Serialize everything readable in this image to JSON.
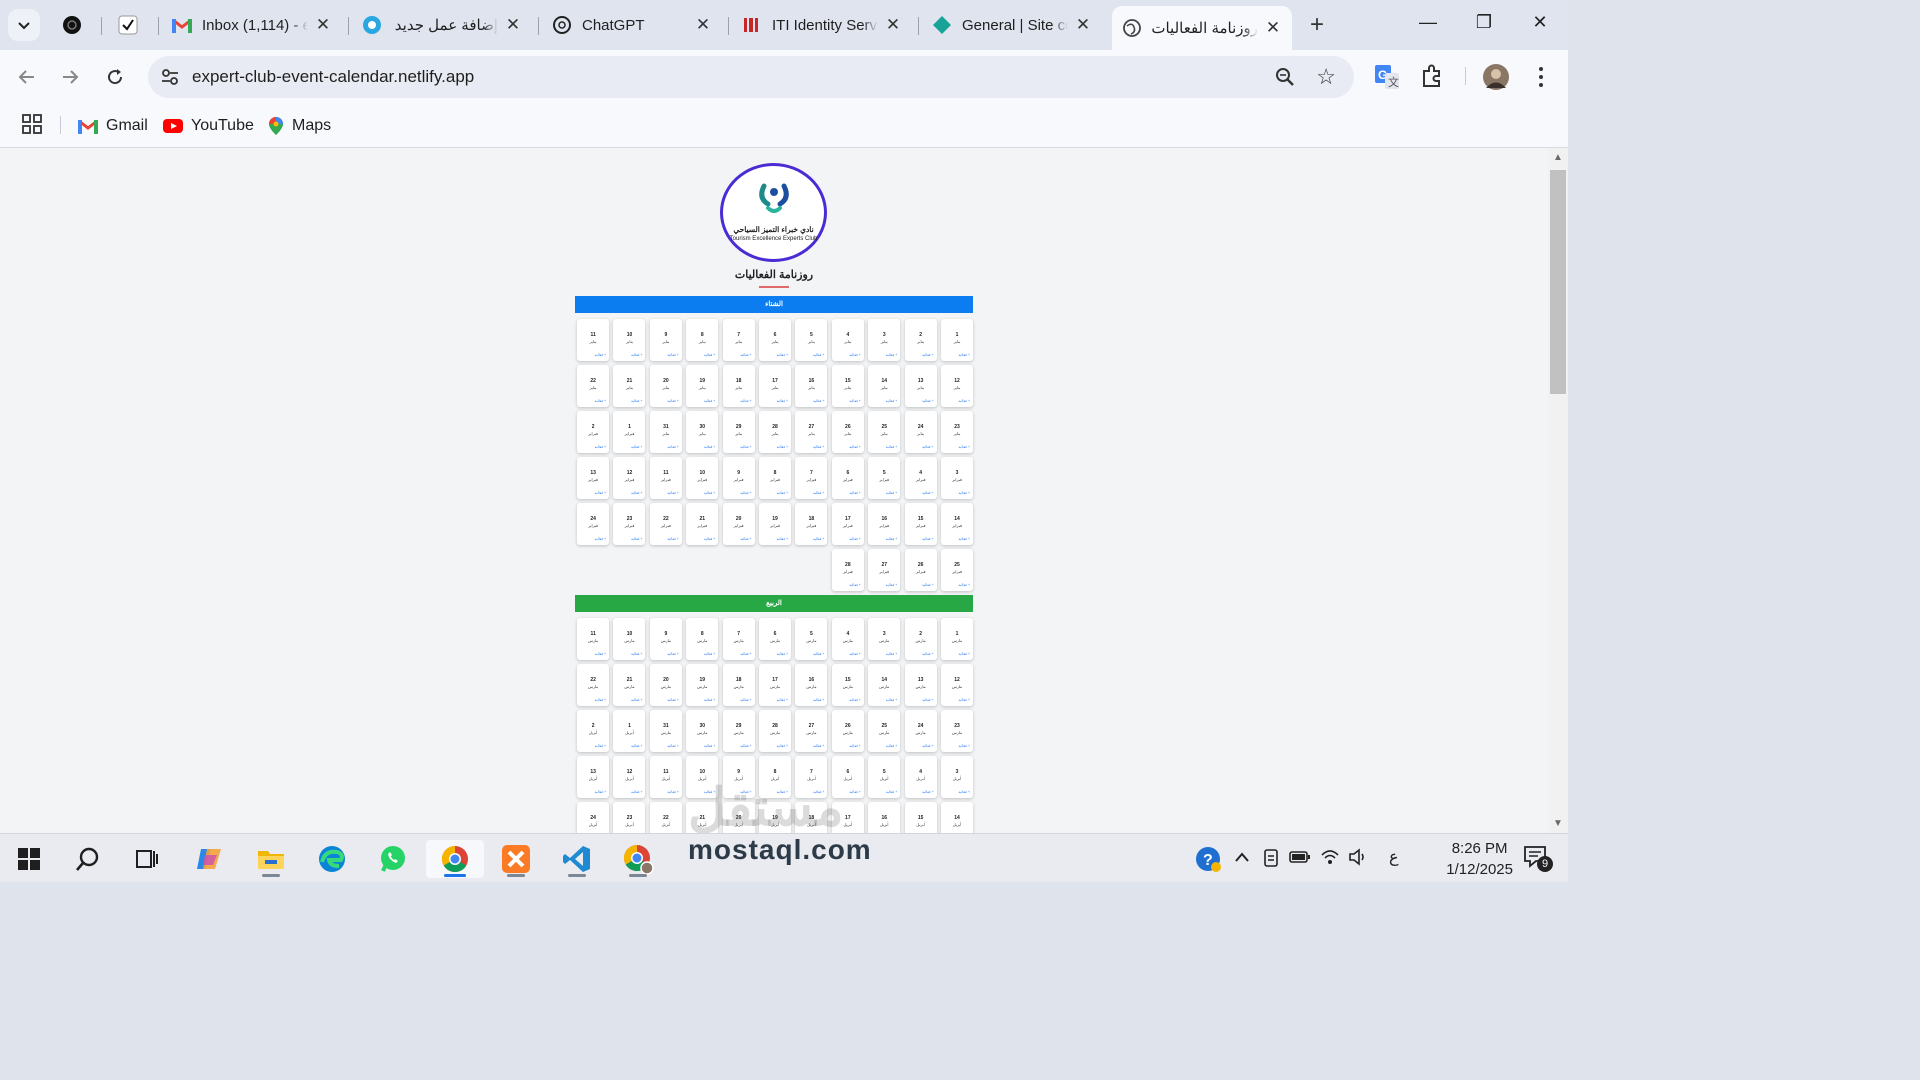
{
  "browser": {
    "tabs": [
      {
        "title": "",
        "favicon": "openai-dark-icon",
        "close": ""
      },
      {
        "title": "",
        "favicon": "checkmark-icon",
        "close": ""
      },
      {
        "title": "Inbox (1,114) - e",
        "favicon": "gmail-icon",
        "close": "✕"
      },
      {
        "title": "إضافة عمل جديد",
        "favicon": "mostaql-icon",
        "close": "✕"
      },
      {
        "title": "ChatGPT",
        "favicon": "chatgpt-icon",
        "close": "✕"
      },
      {
        "title": "ITI Identity Serv",
        "favicon": "iti-icon",
        "close": "✕"
      },
      {
        "title": "General | Site co",
        "favicon": "diamond-icon",
        "close": "✕"
      },
      {
        "title": "روزنامة الفعاليات",
        "favicon": "globe-icon",
        "close": "✕",
        "active": true
      }
    ],
    "new_tab": "+",
    "window_controls": {
      "minimize": "—",
      "restore": "❐",
      "close": "✕"
    },
    "url": "expert-club-event-calendar.netlify.app",
    "bookmarks": [
      {
        "label": "Gmail",
        "icon": "gmail-icon"
      },
      {
        "label": "YouTube",
        "icon": "youtube-icon"
      },
      {
        "label": "Maps",
        "icon": "maps-pin-icon"
      }
    ]
  },
  "page": {
    "logo": {
      "arabic": "نادي خبراء التميز السياحي",
      "english": "Tourism Excellence Experts Club"
    },
    "title": "روزنامة الفعاليات",
    "add_label": "+ فعالية",
    "seasons": [
      {
        "name": "الشتاء",
        "color": "#0b7df0",
        "days": [
          {
            "d": "1",
            "m": "يناير"
          },
          {
            "d": "2",
            "m": "يناير"
          },
          {
            "d": "3",
            "m": "يناير"
          },
          {
            "d": "4",
            "m": "يناير"
          },
          {
            "d": "5",
            "m": "يناير"
          },
          {
            "d": "6",
            "m": "يناير"
          },
          {
            "d": "7",
            "m": "يناير"
          },
          {
            "d": "8",
            "m": "يناير"
          },
          {
            "d": "9",
            "m": "يناير"
          },
          {
            "d": "10",
            "m": "يناير"
          },
          {
            "d": "11",
            "m": "يناير"
          },
          {
            "d": "12",
            "m": "يناير"
          },
          {
            "d": "13",
            "m": "يناير"
          },
          {
            "d": "14",
            "m": "يناير"
          },
          {
            "d": "15",
            "m": "يناير"
          },
          {
            "d": "16",
            "m": "يناير"
          },
          {
            "d": "17",
            "m": "يناير"
          },
          {
            "d": "18",
            "m": "يناير"
          },
          {
            "d": "19",
            "m": "يناير"
          },
          {
            "d": "20",
            "m": "يناير"
          },
          {
            "d": "21",
            "m": "يناير"
          },
          {
            "d": "22",
            "m": "يناير"
          },
          {
            "d": "23",
            "m": "يناير"
          },
          {
            "d": "24",
            "m": "يناير"
          },
          {
            "d": "25",
            "m": "يناير"
          },
          {
            "d": "26",
            "m": "يناير"
          },
          {
            "d": "27",
            "m": "يناير"
          },
          {
            "d": "28",
            "m": "يناير"
          },
          {
            "d": "29",
            "m": "يناير"
          },
          {
            "d": "30",
            "m": "يناير"
          },
          {
            "d": "31",
            "m": "يناير"
          },
          {
            "d": "1",
            "m": "فبراير"
          },
          {
            "d": "2",
            "m": "فبراير"
          },
          {
            "d": "3",
            "m": "فبراير"
          },
          {
            "d": "4",
            "m": "فبراير"
          },
          {
            "d": "5",
            "m": "فبراير"
          },
          {
            "d": "6",
            "m": "فبراير"
          },
          {
            "d": "7",
            "m": "فبراير"
          },
          {
            "d": "8",
            "m": "فبراير"
          },
          {
            "d": "9",
            "m": "فبراير"
          },
          {
            "d": "10",
            "m": "فبراير"
          },
          {
            "d": "11",
            "m": "فبراير"
          },
          {
            "d": "12",
            "m": "فبراير"
          },
          {
            "d": "13",
            "m": "فبراير"
          },
          {
            "d": "14",
            "m": "فبراير"
          },
          {
            "d": "15",
            "m": "فبراير"
          },
          {
            "d": "16",
            "m": "فبراير"
          },
          {
            "d": "17",
            "m": "فبراير"
          },
          {
            "d": "18",
            "m": "فبراير"
          },
          {
            "d": "19",
            "m": "فبراير"
          },
          {
            "d": "20",
            "m": "فبراير"
          },
          {
            "d": "21",
            "m": "فبراير"
          },
          {
            "d": "22",
            "m": "فبراير"
          },
          {
            "d": "23",
            "m": "فبراير"
          },
          {
            "d": "24",
            "m": "فبراير"
          },
          {
            "d": "25",
            "m": "فبراير"
          },
          {
            "d": "26",
            "m": "فبراير"
          },
          {
            "d": "27",
            "m": "فبراير"
          },
          {
            "d": "28",
            "m": "فبراير"
          }
        ]
      },
      {
        "name": "الربيع",
        "color": "#28a745",
        "days": [
          {
            "d": "1",
            "m": "مارس"
          },
          {
            "d": "2",
            "m": "مارس"
          },
          {
            "d": "3",
            "m": "مارس"
          },
          {
            "d": "4",
            "m": "مارس"
          },
          {
            "d": "5",
            "m": "مارس"
          },
          {
            "d": "6",
            "m": "مارس"
          },
          {
            "d": "7",
            "m": "مارس"
          },
          {
            "d": "8",
            "m": "مارس"
          },
          {
            "d": "9",
            "m": "مارس"
          },
          {
            "d": "10",
            "m": "مارس"
          },
          {
            "d": "11",
            "m": "مارس"
          },
          {
            "d": "12",
            "m": "مارس"
          },
          {
            "d": "13",
            "m": "مارس"
          },
          {
            "d": "14",
            "m": "مارس"
          },
          {
            "d": "15",
            "m": "مارس"
          },
          {
            "d": "16",
            "m": "مارس"
          },
          {
            "d": "17",
            "m": "مارس"
          },
          {
            "d": "18",
            "m": "مارس"
          },
          {
            "d": "19",
            "m": "مارس"
          },
          {
            "d": "20",
            "m": "مارس"
          },
          {
            "d": "21",
            "m": "مارس"
          },
          {
            "d": "22",
            "m": "مارس"
          },
          {
            "d": "23",
            "m": "مارس"
          },
          {
            "d": "24",
            "m": "مارس"
          },
          {
            "d": "25",
            "m": "مارس"
          },
          {
            "d": "26",
            "m": "مارس"
          },
          {
            "d": "27",
            "m": "مارس"
          },
          {
            "d": "28",
            "m": "مارس"
          },
          {
            "d": "29",
            "m": "مارس"
          },
          {
            "d": "30",
            "m": "مارس"
          },
          {
            "d": "31",
            "m": "مارس"
          },
          {
            "d": "1",
            "m": "أبريل"
          },
          {
            "d": "2",
            "m": "أبريل"
          },
          {
            "d": "3",
            "m": "أبريل"
          },
          {
            "d": "4",
            "m": "أبريل"
          },
          {
            "d": "5",
            "m": "أبريل"
          },
          {
            "d": "6",
            "m": "أبريل"
          },
          {
            "d": "7",
            "m": "أبريل"
          },
          {
            "d": "8",
            "m": "أبريل"
          },
          {
            "d": "9",
            "m": "أبريل"
          },
          {
            "d": "10",
            "m": "أبريل"
          },
          {
            "d": "11",
            "m": "أبريل"
          },
          {
            "d": "12",
            "m": "أبريل"
          },
          {
            "d": "13",
            "m": "أبريل"
          },
          {
            "d": "14",
            "m": "أبريل"
          },
          {
            "d": "15",
            "m": "أبريل"
          },
          {
            "d": "16",
            "m": "أبريل"
          },
          {
            "d": "17",
            "m": "أبريل"
          },
          {
            "d": "18",
            "m": "أبريل"
          },
          {
            "d": "19",
            "m": "أبريل"
          },
          {
            "d": "20",
            "m": "أبريل"
          },
          {
            "d": "21",
            "m": "أبريل"
          },
          {
            "d": "22",
            "m": "أبريل"
          },
          {
            "d": "23",
            "m": "أبريل"
          },
          {
            "d": "24",
            "m": "أبريل"
          }
        ]
      }
    ]
  },
  "watermark": {
    "logo_text": "مستقل",
    "site": "mostaql.com"
  },
  "taskbar": {
    "apps": [
      "windows-start-icon",
      "search-icon",
      "task-view-icon",
      "copilot-icon",
      "file-explorer-icon",
      "edge-icon",
      "whatsapp-icon",
      "chrome-icon",
      "xampp-icon",
      "vscode-icon",
      "chrome-profile-icon"
    ],
    "tray_lang": "ع",
    "time": "8:26 PM",
    "date": "1/12/2025",
    "notifications": "9"
  }
}
